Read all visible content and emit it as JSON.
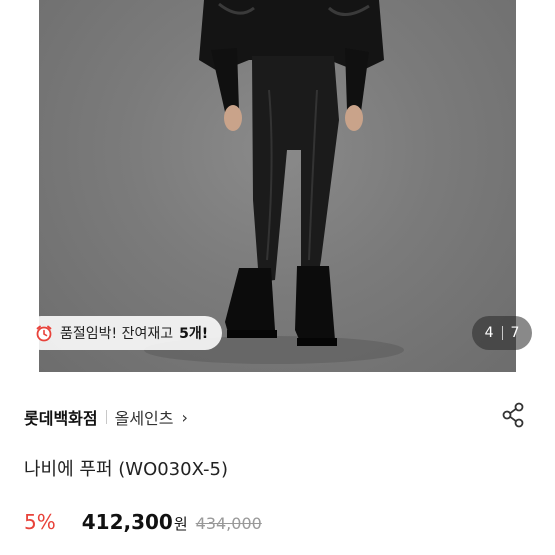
{
  "gallery": {
    "stock_alert": "품절임박! 잔여재고",
    "stock_count": "5개!",
    "current_page": "4",
    "total_pages": "7"
  },
  "seller": {
    "store_name": "롯데백화점",
    "brand_name": "올세인츠",
    "chevron": "›"
  },
  "product": {
    "title": "나비에 푸퍼 (WO030X-5)"
  },
  "pricing": {
    "discount": "5%",
    "price": "412,300",
    "currency": "원",
    "original_price": "434,000"
  },
  "colors": {
    "discount": "#e8423a",
    "photo_background": "#7b7b7b"
  }
}
